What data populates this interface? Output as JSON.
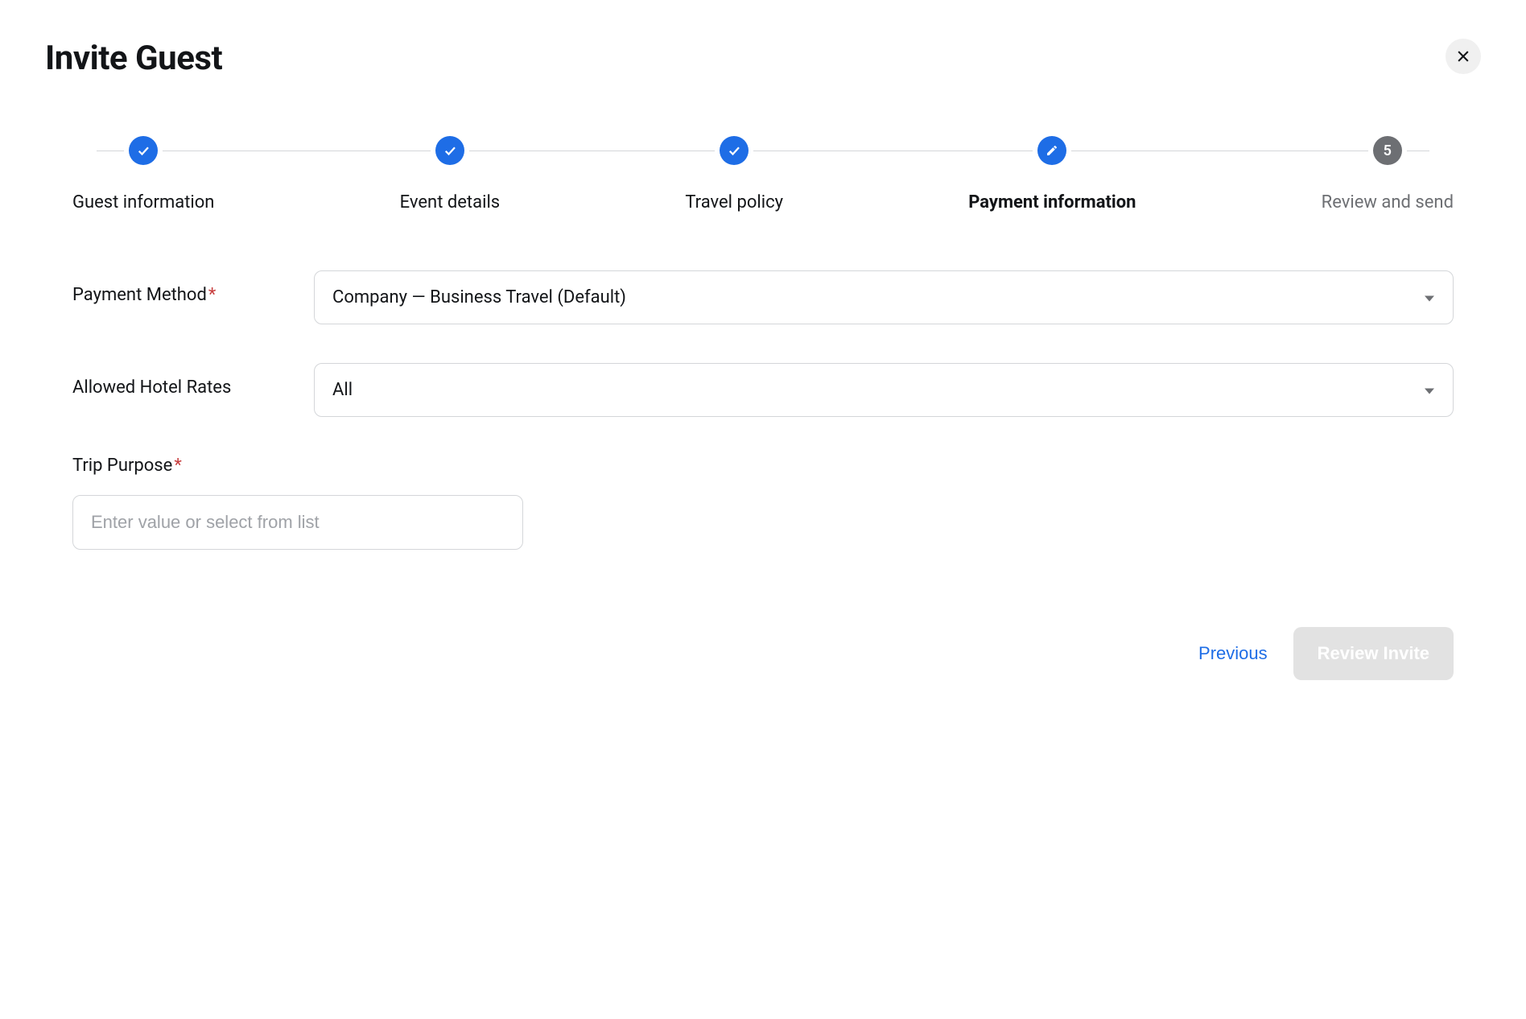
{
  "header": {
    "title": "Invite Guest"
  },
  "stepper": {
    "steps": [
      {
        "label": "Guest information",
        "state": "completed"
      },
      {
        "label": "Event details",
        "state": "completed"
      },
      {
        "label": "Travel policy",
        "state": "completed"
      },
      {
        "label": "Payment information",
        "state": "current"
      },
      {
        "label": "Review and send",
        "state": "upcoming",
        "number": "5"
      }
    ]
  },
  "form": {
    "payment_method": {
      "label": "Payment Method",
      "required": true,
      "value": "Company — Business Travel (Default)"
    },
    "allowed_hotel_rates": {
      "label": "Allowed Hotel Rates",
      "required": false,
      "value": "All"
    },
    "trip_purpose": {
      "label": "Trip Purpose",
      "required": true,
      "placeholder": "Enter value or select from list",
      "value": ""
    }
  },
  "footer": {
    "previous_label": "Previous",
    "review_label": "Review Invite"
  }
}
